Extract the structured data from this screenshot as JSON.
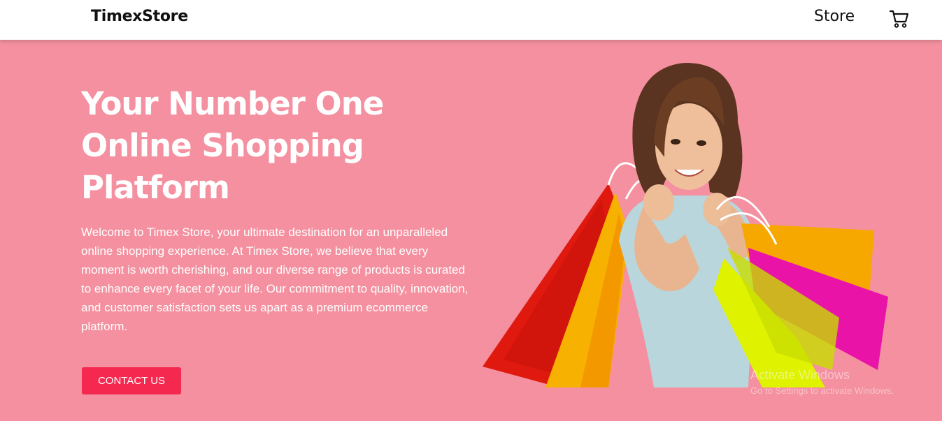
{
  "navbar": {
    "brand": "TimexStore",
    "store_link": "Store",
    "cart_icon": "cart-icon"
  },
  "hero": {
    "title": "Your Number One Online Shopping Platform",
    "description": "Welcome to Timex Store, your ultimate destination for an unparalleled online shopping experience. At Timex Store, we believe that every moment is worth cherishing, and our diverse range of products is curated to enhance every facet of your life. Our commitment to quality, innovation, and customer satisfaction sets us apart as a premium ecommerce platform.",
    "cta_label": "CONTACT US",
    "image_subject": "woman-with-shopping-bags"
  },
  "watermark": {
    "title": "Activate Windows",
    "subtitle": "Go to Settings to activate Windows."
  },
  "colors": {
    "hero_background": "#f4909f",
    "cta_background": "#f5284f",
    "navbar_background": "#ffffff"
  }
}
